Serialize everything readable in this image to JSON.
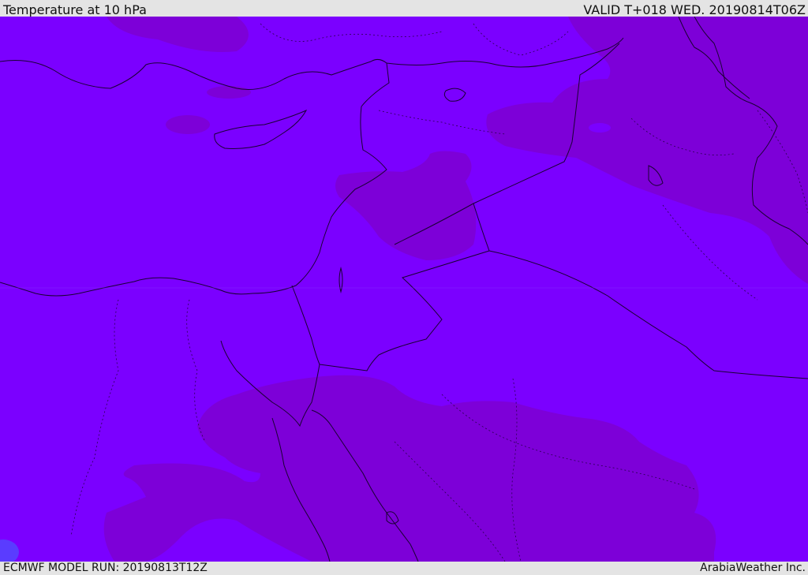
{
  "header": {
    "title": "Temperature at 10 hPa",
    "valid": "VALID T+018 WED. 20190814T06Z"
  },
  "footer": {
    "model_run": "ECMWF MODEL RUN: 20190813T12Z",
    "credit": "ArabiaWeather Inc."
  },
  "map": {
    "variable": "temperature",
    "level": "10 hPa",
    "colors": {
      "warm_field": "#7b00ff",
      "cool_field": "#7d00d8",
      "coldest_spot": "#5a3cff",
      "lines": "#1a0033"
    }
  }
}
